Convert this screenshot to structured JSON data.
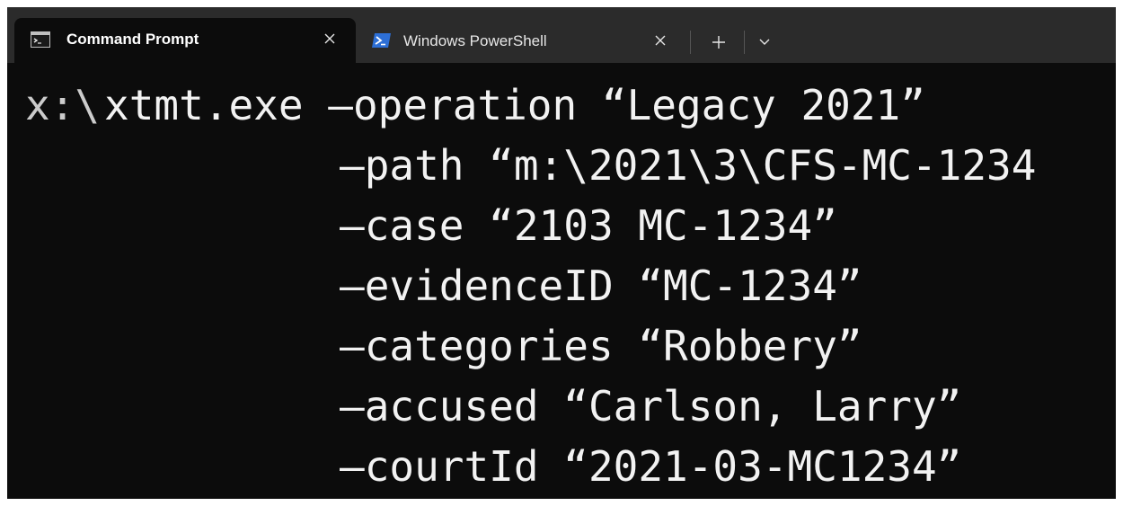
{
  "tabs": [
    {
      "label": "Command Prompt",
      "icon": "cmd-icon",
      "active": true
    },
    {
      "label": "Windows PowerShell",
      "icon": "powershell-icon",
      "active": false
    }
  ],
  "terminal": {
    "prompt": "x:\\",
    "lines": [
      "xtmt.exe –operation “Legacy 2021”",
      "–path “m:\\2021\\3\\CFS-MC-1234",
      "–case “2103 MC-1234”",
      "–evidenceID “MC-1234”",
      "–categories “Robbery”",
      "–accused “Carlson, Larry”",
      "–courtId “2021-03-MC1234”"
    ]
  },
  "colors": {
    "terminal_bg": "#0c0c0c",
    "tabbar_bg": "#2b2b2b",
    "text": "#f2f2f2",
    "powershell_blue": "#2d6fd6"
  }
}
